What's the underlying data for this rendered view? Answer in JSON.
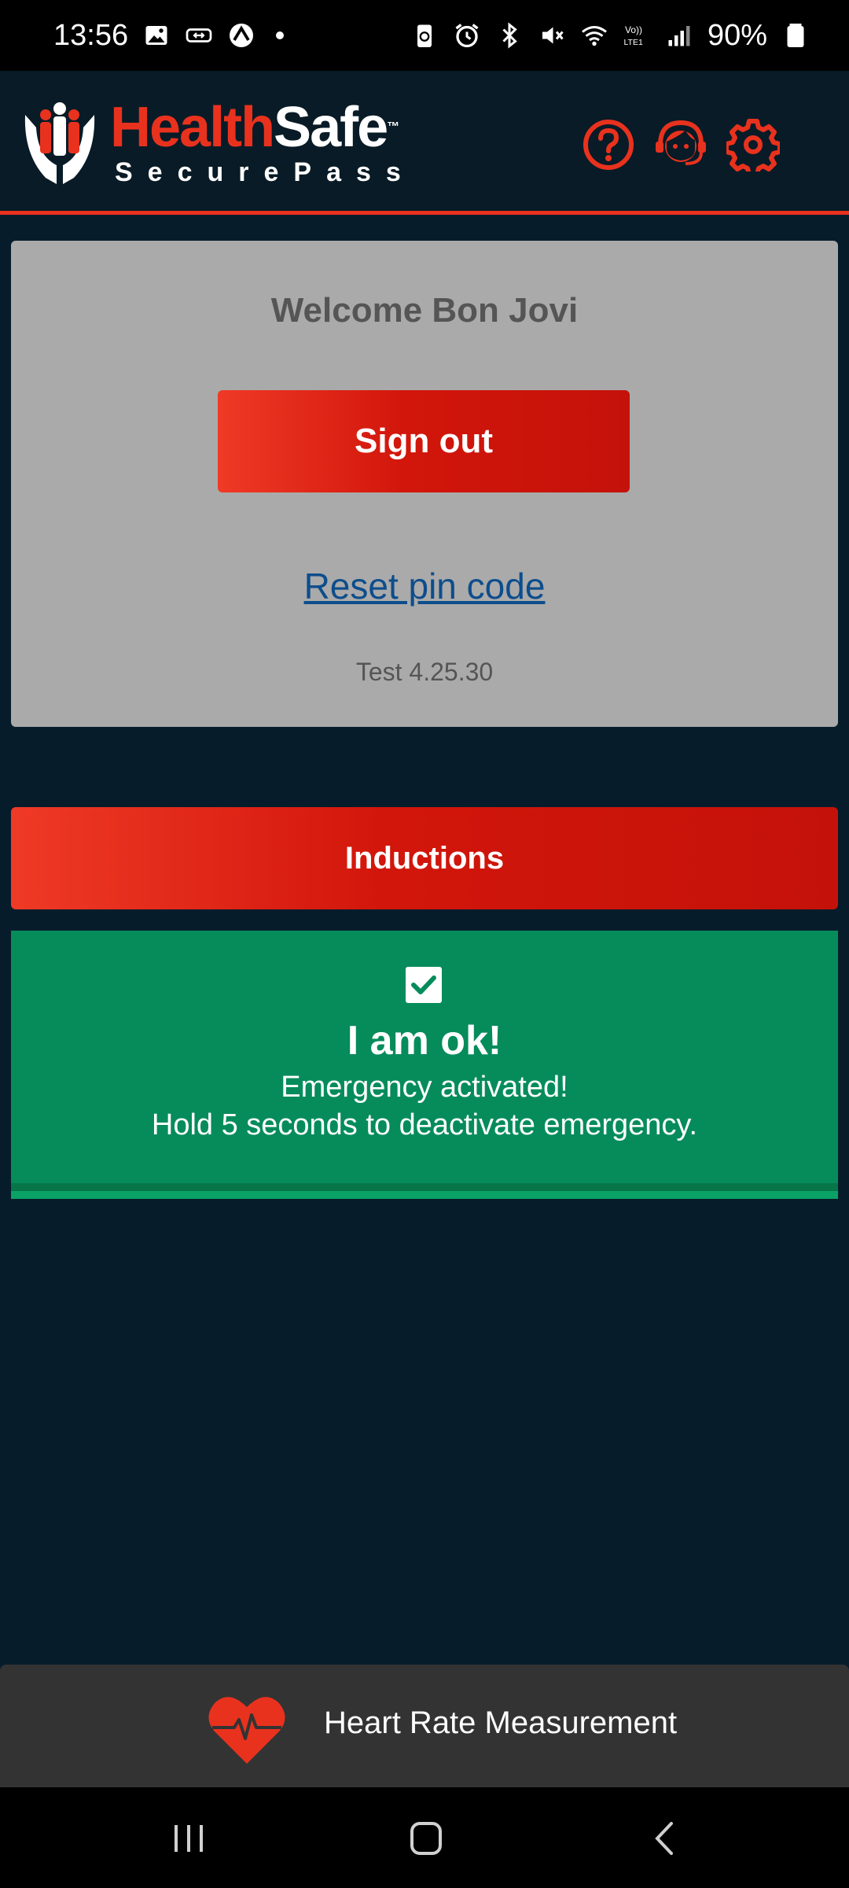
{
  "status_bar": {
    "time": "13:56",
    "battery": "90%",
    "left_icons": [
      "image-icon",
      "cast-icon",
      "app-icon"
    ],
    "right_icons": [
      "battery-saver-icon",
      "alarm-icon",
      "bluetooth-icon",
      "mute-icon",
      "wifi-icon",
      "volte-icon",
      "signal-icon",
      "battery-icon"
    ]
  },
  "header": {
    "brand_health": "Health",
    "brand_safe": "Safe",
    "brand_tm": "™",
    "brand_sub": "SecurePass",
    "icons": [
      "help-icon",
      "support-agent-icon",
      "settings-icon"
    ]
  },
  "welcome": {
    "title": "Welcome Bon Jovi",
    "signout_label": "Sign out",
    "reset_label": "Reset pin code",
    "version": "Test 4.25.30"
  },
  "inductions": {
    "label": "Inductions"
  },
  "emergency": {
    "title": "I am ok!",
    "line1": "Emergency activated!",
    "line2": "Hold 5 seconds to deactivate emergency.",
    "checked": true
  },
  "heart_rate": {
    "label": "Heart Rate Measurement"
  },
  "nav": {
    "items": [
      "recents-icon",
      "home-icon",
      "back-icon"
    ]
  },
  "colors": {
    "accent": "#e8321e",
    "background": "#071c2b",
    "card": "#aaaaaa",
    "success": "#068c5b",
    "link": "#0d4d8c"
  }
}
